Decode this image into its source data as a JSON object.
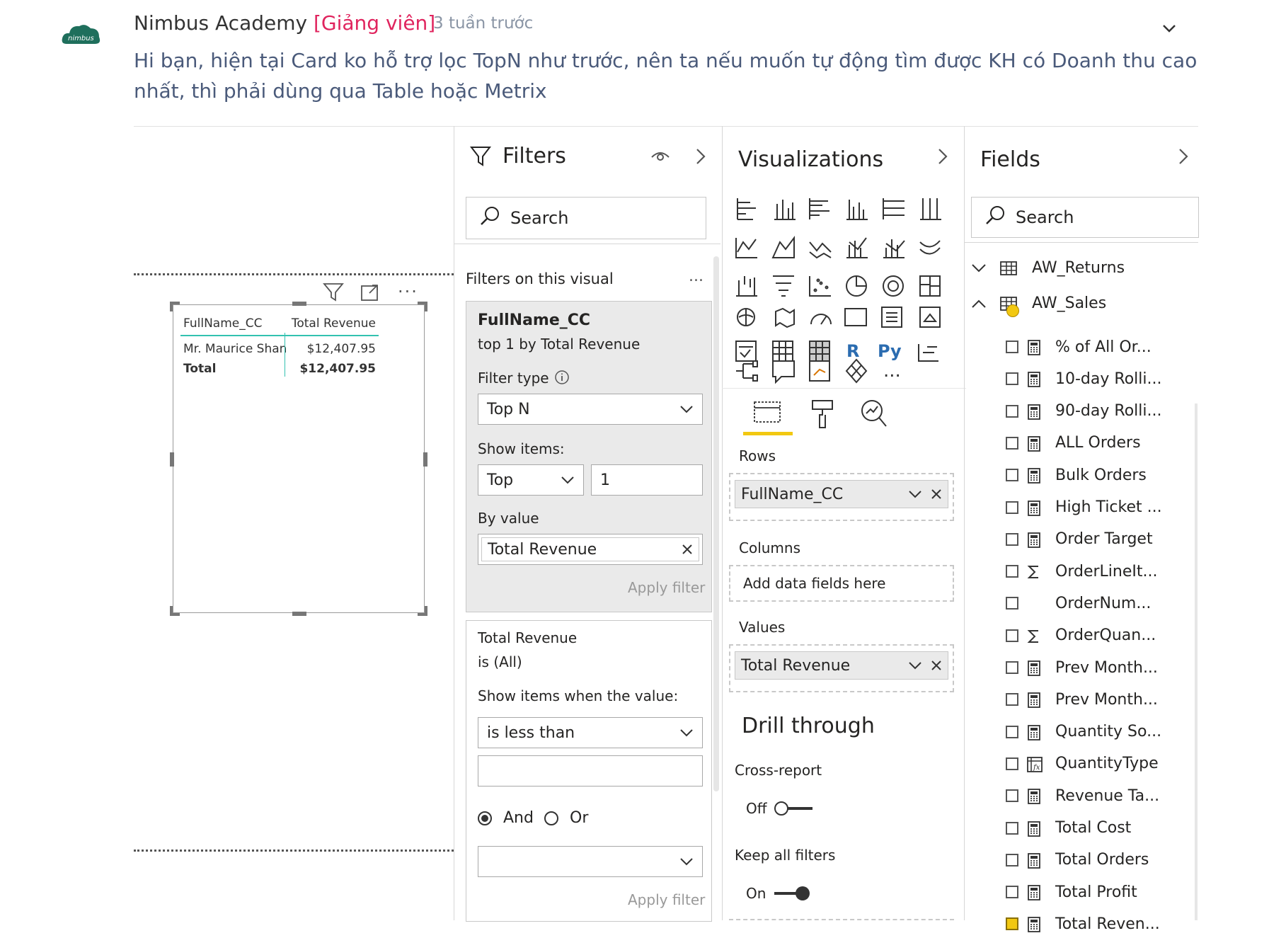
{
  "comment": {
    "avatar_text": "nimbus",
    "author": "Nimbus Academy",
    "role": "[Giảng viên]",
    "time": "3 tuần trước",
    "body": "Hi bạn, hiện tại Card ko hỗ trợ lọc TopN như trước, nên ta nếu muốn tự động tìm được KH có Doanh thu cao nhất, thì phải dùng qua Table hoặc Metrix"
  },
  "visual_table": {
    "headers": [
      "FullName_CC",
      "Total Revenue"
    ],
    "rows": [
      [
        "Mr. Maurice Shan",
        "$12,407.95"
      ]
    ],
    "total": [
      "Total",
      "$12,407.95"
    ]
  },
  "filters": {
    "title": "Filters",
    "search_placeholder": "Search",
    "section": "Filters on this visual",
    "more": "...",
    "card1": {
      "field": "FullName_CC",
      "summary": "top 1 by Total Revenue",
      "filter_type_label": "Filter type",
      "filter_type": "Top N",
      "show_items_label": "Show items:",
      "show_items_dir": "Top",
      "show_items_count": "1",
      "by_value_label": "By value",
      "by_value": "Total Revenue",
      "apply": "Apply filter"
    },
    "card2": {
      "field": "Total Revenue",
      "summary": "is (All)",
      "show_when_label": "Show items when the value:",
      "condition": "is less than",
      "and": "And",
      "or": "Or",
      "apply": "Apply filter"
    }
  },
  "visualizations": {
    "title": "Visualizations",
    "rows_label": "Rows",
    "rows_field": "FullName_CC",
    "columns_label": "Columns",
    "columns_placeholder": "Add data fields here",
    "values_label": "Values",
    "values_field": "Total Revenue",
    "drill_title": "Drill through",
    "cross_report": "Cross-report",
    "cross_state": "Off",
    "keep_filters": "Keep all filters",
    "keep_state": "On",
    "r_label": "R",
    "py_label": "Py",
    "more_visuals": "..."
  },
  "fields": {
    "title": "Fields",
    "search_placeholder": "Search",
    "tables": [
      "AW_Returns",
      "AW_Sales"
    ],
    "items": [
      {
        "name": "% of All Or...",
        "icon": "calculator-icon",
        "checked": false
      },
      {
        "name": "10-day Rolli...",
        "icon": "calculator-icon",
        "checked": false
      },
      {
        "name": "90-day Rolli...",
        "icon": "calculator-icon",
        "checked": false
      },
      {
        "name": "ALL Orders",
        "icon": "calculator-icon",
        "checked": false
      },
      {
        "name": "Bulk Orders",
        "icon": "calculator-icon",
        "checked": false
      },
      {
        "name": "High Ticket ...",
        "icon": "calculator-icon",
        "checked": false
      },
      {
        "name": "Order Target",
        "icon": "calculator-icon",
        "checked": false
      },
      {
        "name": "OrderLineIt...",
        "icon": "sigma-icon",
        "checked": false
      },
      {
        "name": "OrderNum...",
        "icon": "",
        "checked": false
      },
      {
        "name": "OrderQuan...",
        "icon": "sigma-icon",
        "checked": false
      },
      {
        "name": "Prev Month...",
        "icon": "calculator-icon",
        "checked": false
      },
      {
        "name": "Prev Month...",
        "icon": "calculator-icon",
        "checked": false
      },
      {
        "name": "Quantity So...",
        "icon": "calculator-icon",
        "checked": false
      },
      {
        "name": "QuantityType",
        "icon": "calculated-column-icon",
        "checked": false
      },
      {
        "name": "Revenue Ta...",
        "icon": "calculator-icon",
        "checked": false
      },
      {
        "name": "Total Cost",
        "icon": "calculator-icon",
        "checked": false
      },
      {
        "name": "Total Orders",
        "icon": "calculator-icon",
        "checked": false
      },
      {
        "name": "Total Profit",
        "icon": "calculator-icon",
        "checked": false
      },
      {
        "name": "Total Reven...",
        "icon": "calculator-icon",
        "checked": true
      }
    ]
  },
  "colors": {
    "accent_yellow": "#f2c811",
    "table_teal": "#33c2b0",
    "role_pink": "#e0245e"
  }
}
